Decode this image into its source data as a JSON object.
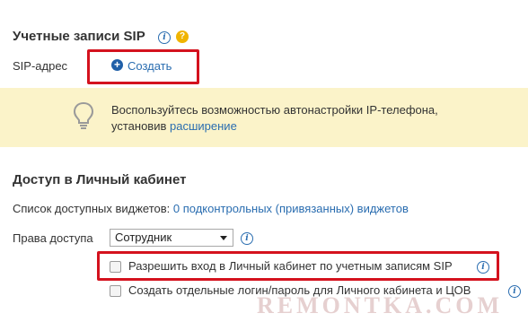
{
  "sip_section": {
    "title": "Учетные записи SIP",
    "sip_address_label": "SIP-адрес",
    "create_label": "Создать"
  },
  "banner": {
    "line1": "Воспользуйтесь возможностью автонастройки IP-телефона,",
    "line2_prefix": "установив",
    "line2_link": "расширение"
  },
  "access_section": {
    "title": "Доступ в Личный кабинет",
    "widgets_label": "Список доступных виджетов:",
    "widgets_link": "0 подконтрольных (привязанных) виджетов",
    "rights_label": "Права доступа",
    "rights_selected": "Сотрудник",
    "checkbox1_label": "Разрешить вход в Личный кабинет по учетным записям SIP",
    "checkbox2_label": "Создать отдельные логин/пароль для Личного кабинета и ЦОВ"
  },
  "watermark": "REMONTKA.COM",
  "colors": {
    "link": "#2a6db0",
    "highlight_border": "#d4121e",
    "banner_bg": "#fbf3c9",
    "help_icon": "#f0b400"
  }
}
